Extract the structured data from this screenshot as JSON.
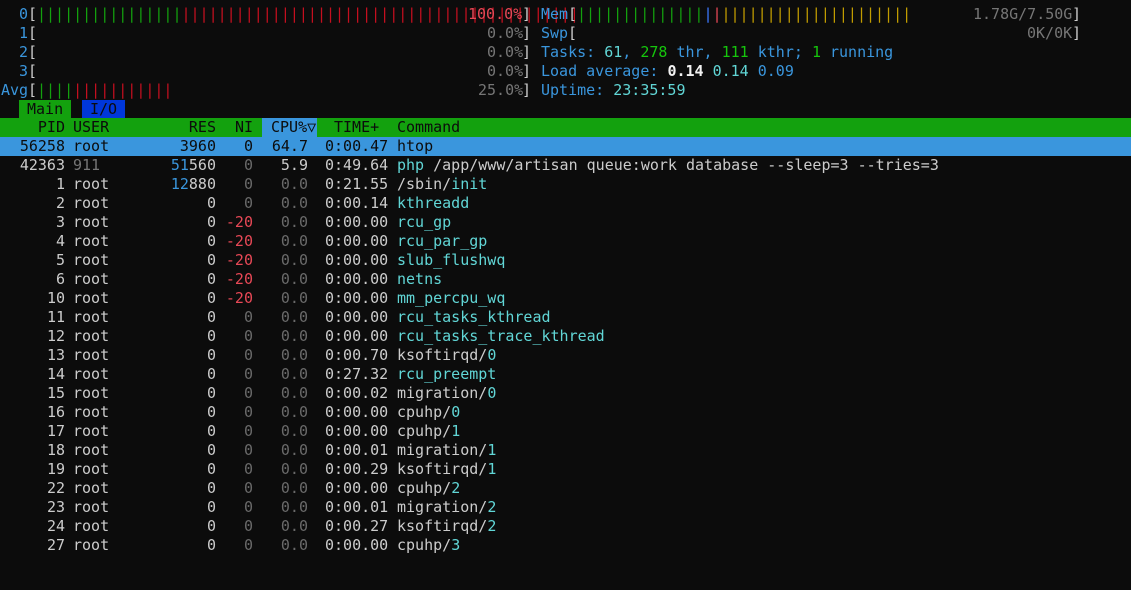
{
  "meters": {
    "cpu": [
      {
        "label": "0",
        "pct": "100.0%",
        "bars": [
          {
            "color": "green",
            "count": 16
          },
          {
            "color": "red",
            "count": 44
          }
        ]
      },
      {
        "label": "1",
        "pct": "0.0%",
        "bars": []
      },
      {
        "label": "2",
        "pct": "0.0%",
        "bars": []
      },
      {
        "label": "3",
        "pct": "0.0%",
        "bars": []
      },
      {
        "label": "Avg",
        "pct": "25.0%",
        "bars": [
          {
            "color": "green",
            "count": 4
          },
          {
            "color": "red",
            "count": 11
          }
        ]
      }
    ],
    "mem": {
      "label": "Mem",
      "value": "1.78G/7.50G"
    },
    "swp": {
      "label": "Swp",
      "value": "0K/0K"
    },
    "tasks": {
      "label": "Tasks:",
      "tasks": "61",
      "thr": "278",
      "thr_label": "thr,",
      "kthr": "111",
      "kthr_label": "kthr;",
      "running": "1",
      "running_label": "running"
    },
    "load": {
      "label": "Load average:",
      "v1": "0.14",
      "v5": "0.14",
      "v15": "0.09"
    },
    "uptime": {
      "label": "Uptime:",
      "value": "23:35:59"
    }
  },
  "tabs": {
    "main": "Main",
    "io": "I/O"
  },
  "columns": {
    "pid": "PID",
    "user": "USER",
    "res": "RES",
    "ni": "NI",
    "cpu": "CPU%▽",
    "time": "TIME+",
    "command": "Command"
  },
  "processes": [
    {
      "pid": "56258",
      "user": "root",
      "res": "3960",
      "ni": "0",
      "cpu": "64.7",
      "time": "0:00.47",
      "cmd_base": "htop",
      "cmd_rest": "",
      "selected": true
    },
    {
      "pid": "42363",
      "user": "911",
      "res": "51560",
      "ni": "0",
      "cpu": "5.9",
      "time": "0:49.64",
      "cmd_base": "php",
      "cmd_rest": " /app/www/artisan queue:work database --sleep=3 --tries=3"
    },
    {
      "pid": "1",
      "user": "root",
      "res": "12880",
      "ni": "0",
      "cpu": "0.0",
      "time": "0:21.55",
      "cmd_base": "/sbin/",
      "cmd_rest": "init"
    },
    {
      "pid": "2",
      "user": "root",
      "res": "0",
      "ni": "0",
      "cpu": "0.0",
      "time": "0:00.14",
      "cmd_base": "kthreadd",
      "cmd_rest": "",
      "kernel": true
    },
    {
      "pid": "3",
      "user": "root",
      "res": "0",
      "ni": "-20",
      "cpu": "0.0",
      "time": "0:00.00",
      "cmd_base": "rcu_gp",
      "cmd_rest": "",
      "kernel": true
    },
    {
      "pid": "4",
      "user": "root",
      "res": "0",
      "ni": "-20",
      "cpu": "0.0",
      "time": "0:00.00",
      "cmd_base": "rcu_par_gp",
      "cmd_rest": "",
      "kernel": true
    },
    {
      "pid": "5",
      "user": "root",
      "res": "0",
      "ni": "-20",
      "cpu": "0.0",
      "time": "0:00.00",
      "cmd_base": "slub_flushwq",
      "cmd_rest": "",
      "kernel": true
    },
    {
      "pid": "6",
      "user": "root",
      "res": "0",
      "ni": "-20",
      "cpu": "0.0",
      "time": "0:00.00",
      "cmd_base": "netns",
      "cmd_rest": "",
      "kernel": true
    },
    {
      "pid": "10",
      "user": "root",
      "res": "0",
      "ni": "-20",
      "cpu": "0.0",
      "time": "0:00.00",
      "cmd_base": "mm_percpu_wq",
      "cmd_rest": "",
      "kernel": true
    },
    {
      "pid": "11",
      "user": "root",
      "res": "0",
      "ni": "0",
      "cpu": "0.0",
      "time": "0:00.00",
      "cmd_base": "rcu_tasks_kthread",
      "cmd_rest": "",
      "kernel": true
    },
    {
      "pid": "12",
      "user": "root",
      "res": "0",
      "ni": "0",
      "cpu": "0.0",
      "time": "0:00.00",
      "cmd_base": "rcu_tasks_trace_kthread",
      "cmd_rest": "",
      "kernel": true
    },
    {
      "pid": "13",
      "user": "root",
      "res": "0",
      "ni": "0",
      "cpu": "0.0",
      "time": "0:00.70",
      "cmd_base": "ksoftirqd/",
      "cmd_rest": "0"
    },
    {
      "pid": "14",
      "user": "root",
      "res": "0",
      "ni": "0",
      "cpu": "0.0",
      "time": "0:27.32",
      "cmd_base": "rcu_preempt",
      "cmd_rest": "",
      "kernel": true
    },
    {
      "pid": "15",
      "user": "root",
      "res": "0",
      "ni": "0",
      "cpu": "0.0",
      "time": "0:00.02",
      "cmd_base": "migration/",
      "cmd_rest": "0"
    },
    {
      "pid": "16",
      "user": "root",
      "res": "0",
      "ni": "0",
      "cpu": "0.0",
      "time": "0:00.00",
      "cmd_base": "cpuhp/",
      "cmd_rest": "0"
    },
    {
      "pid": "17",
      "user": "root",
      "res": "0",
      "ni": "0",
      "cpu": "0.0",
      "time": "0:00.00",
      "cmd_base": "cpuhp/",
      "cmd_rest": "1"
    },
    {
      "pid": "18",
      "user": "root",
      "res": "0",
      "ni": "0",
      "cpu": "0.0",
      "time": "0:00.01",
      "cmd_base": "migration/",
      "cmd_rest": "1"
    },
    {
      "pid": "19",
      "user": "root",
      "res": "0",
      "ni": "0",
      "cpu": "0.0",
      "time": "0:00.29",
      "cmd_base": "ksoftirqd/",
      "cmd_rest": "1"
    },
    {
      "pid": "22",
      "user": "root",
      "res": "0",
      "ni": "0",
      "cpu": "0.0",
      "time": "0:00.00",
      "cmd_base": "cpuhp/",
      "cmd_rest": "2"
    },
    {
      "pid": "23",
      "user": "root",
      "res": "0",
      "ni": "0",
      "cpu": "0.0",
      "time": "0:00.01",
      "cmd_base": "migration/",
      "cmd_rest": "2"
    },
    {
      "pid": "24",
      "user": "root",
      "res": "0",
      "ni": "0",
      "cpu": "0.0",
      "time": "0:00.27",
      "cmd_base": "ksoftirqd/",
      "cmd_rest": "2"
    },
    {
      "pid": "27",
      "user": "root",
      "res": "0",
      "ni": "0",
      "cpu": "0.0",
      "time": "0:00.00",
      "cmd_base": "cpuhp/",
      "cmd_rest": "3"
    }
  ]
}
